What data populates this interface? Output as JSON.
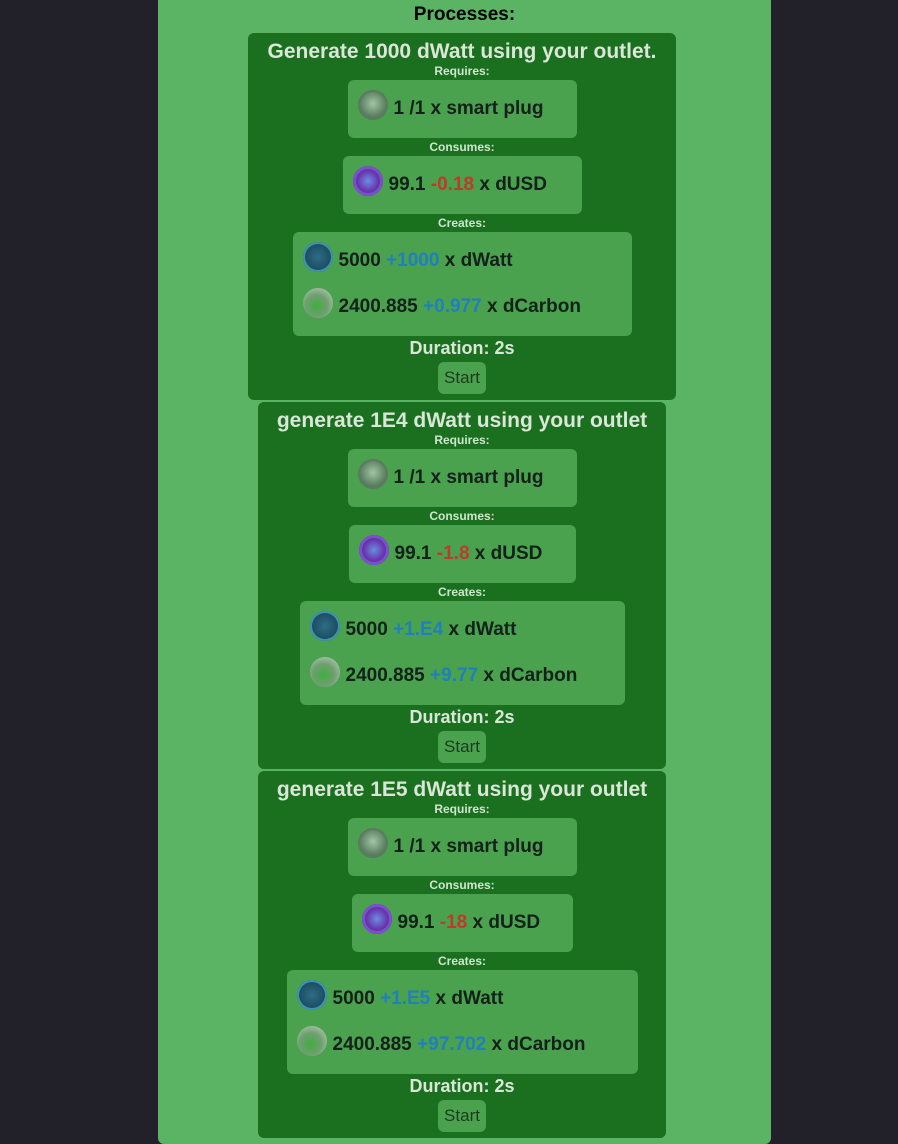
{
  "panel": {
    "title": "Processes:"
  },
  "labels": {
    "requires": "Requires:",
    "consumes": "Consumes:",
    "creates": "Creates:",
    "start": "Start"
  },
  "processes": [
    {
      "title": "Generate 1000 dWatt using your outlet.",
      "requires": {
        "amount": "1 /1",
        "suffix": "x smart plug",
        "icon": "smart-plug-icon"
      },
      "consumes": {
        "amount": "99.1",
        "delta": "-0.18",
        "suffix": "x dUSD",
        "icon": "dusd-icon"
      },
      "creates": [
        {
          "amount": "5000",
          "delta": "+1000",
          "suffix": "x dWatt",
          "icon": "dwatt-icon"
        },
        {
          "amount": "2400.885",
          "delta": "+0.977",
          "suffix": "x dCarbon",
          "icon": "dcarbon-icon"
        }
      ],
      "duration": "Duration: 2s"
    },
    {
      "title": "generate 1E4 dWatt using your outlet",
      "requires": {
        "amount": "1 /1",
        "suffix": "x smart plug",
        "icon": "smart-plug-icon"
      },
      "consumes": {
        "amount": "99.1",
        "delta": "-1.8",
        "suffix": "x dUSD",
        "icon": "dusd-icon"
      },
      "creates": [
        {
          "amount": "5000",
          "delta": "+1.E4",
          "suffix": "x dWatt",
          "icon": "dwatt-icon"
        },
        {
          "amount": "2400.885",
          "delta": "+9.77",
          "suffix": "x dCarbon",
          "icon": "dcarbon-icon"
        }
      ],
      "duration": "Duration: 2s"
    },
    {
      "title": "generate 1E5 dWatt using your outlet",
      "requires": {
        "amount": "1 /1",
        "suffix": "x smart plug",
        "icon": "smart-plug-icon"
      },
      "consumes": {
        "amount": "99.1",
        "delta": "-18",
        "suffix": "x dUSD",
        "icon": "dusd-icon"
      },
      "creates": [
        {
          "amount": "5000",
          "delta": "+1.E5",
          "suffix": "x dWatt",
          "icon": "dwatt-icon"
        },
        {
          "amount": "2400.885",
          "delta": "+97.702",
          "suffix": "x dCarbon",
          "icon": "dcarbon-icon"
        }
      ],
      "duration": "Duration: 2s"
    }
  ],
  "colors": {
    "background": "#222129",
    "panel": "#5bb463",
    "card": "#1a701e",
    "box": "#4aa24f",
    "negative_delta": "#c0392b",
    "positive_delta": "#1f7fbf"
  }
}
